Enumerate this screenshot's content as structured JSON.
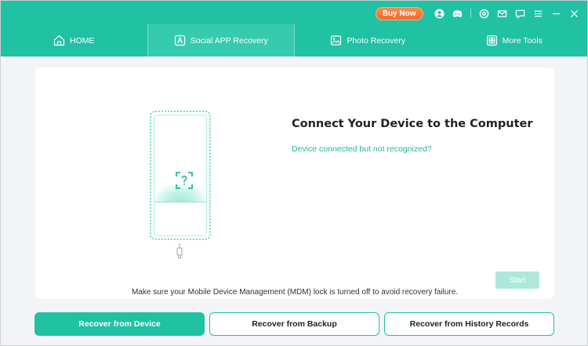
{
  "titlebar": {
    "buy_now": "Buy Now",
    "icons": [
      "account-icon",
      "discord-icon",
      "settings-icon",
      "mail-icon",
      "feedback-icon",
      "menu-icon",
      "minimize-icon",
      "close-icon"
    ]
  },
  "nav": {
    "tabs": [
      {
        "label": "HOME",
        "icon": "home-icon",
        "active": false
      },
      {
        "label": "Social APP Recovery",
        "icon": "social-app-icon",
        "active": true
      },
      {
        "label": "Photo Recovery",
        "icon": "photo-icon",
        "active": false
      },
      {
        "label": "More Tools",
        "icon": "tools-icon",
        "active": false
      }
    ]
  },
  "main": {
    "title": "Connect Your Device to the Computer",
    "help_link": "Device connected but not recognized?",
    "start_button": "Start",
    "note": "Make sure your Mobile Device Management (MDM) lock is turned off to avoid recovery failure."
  },
  "bottom": {
    "buttons": [
      "Recover from Device",
      "Recover from Backup",
      "Recover from History Records"
    ]
  },
  "colors": {
    "accent": "#21c1a3",
    "buy_now": "#f56a2a",
    "start_disabled": "#aee8db"
  }
}
